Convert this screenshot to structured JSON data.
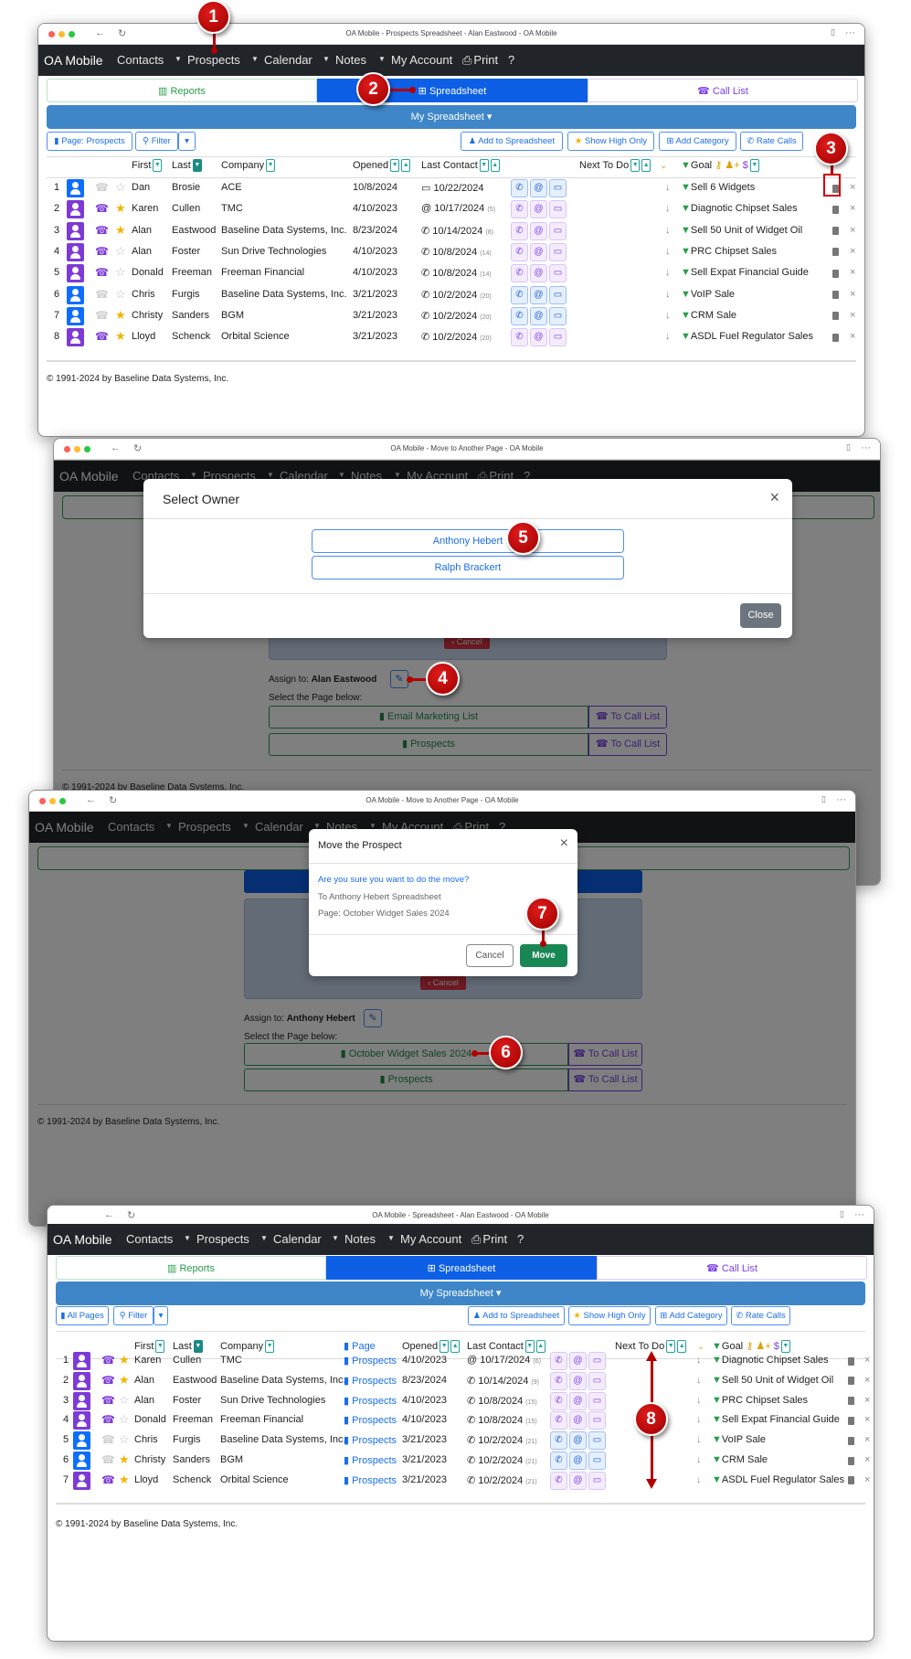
{
  "nav": {
    "brand": "OA Mobile",
    "items": [
      "Contacts",
      "Prospects",
      "Calendar",
      "Notes",
      "My Account",
      "Print",
      "?"
    ]
  },
  "colors": {
    "nav_bg": "#212529",
    "spreadsheet_tab": "#0d5fe6",
    "reports_text": "#2a9d4a",
    "call_list_text": "#7b3fe4",
    "person_blue": "#0d6efd",
    "person_purple": "#7d3ad6",
    "teal_sort": "#20a39e",
    "move_button": "#198754",
    "close_button": "#6c757d",
    "cancel_red": "#dc3545",
    "callout_red": "#b30000"
  },
  "callouts": [
    "1",
    "2",
    "3",
    "4",
    "5",
    "6",
    "7",
    "8"
  ],
  "window1": {
    "title": "OA Mobile - Prospects Spreadsheet - Alan Eastwood - OA Mobile",
    "tabs": {
      "reports": "Reports",
      "spreadsheet": "Spreadsheet",
      "call_list": "Call List"
    },
    "my_spreadsheet": "My Spreadsheet",
    "toolbar": {
      "page": "Page: Prospects",
      "filter": "Filter",
      "add": "Add to Spreadsheet",
      "high": "Show High Only",
      "category": "Add Category",
      "rate": "Rate Calls"
    },
    "headers": {
      "first": "First",
      "last": "Last",
      "company": "Company",
      "opened": "Opened",
      "last_contact": "Last Contact",
      "next": "Next To Do",
      "goal": "Goal"
    },
    "rows": [
      {
        "n": "1",
        "color": "blue",
        "star": false,
        "first": "Dan",
        "last": "Brosie",
        "company": "ACE",
        "opened": "10/8/2024",
        "lc_icon": "comment",
        "last_contact": "10/22/2024",
        "days": "",
        "goal": "Sell 6 Widgets"
      },
      {
        "n": "2",
        "color": "purple",
        "star": true,
        "first": "Karen",
        "last": "Cullen",
        "company": "TMC",
        "opened": "4/10/2023",
        "lc_icon": "email",
        "last_contact": "10/17/2024",
        "days": "(5)",
        "goal": "Diagnotic Chipset Sales"
      },
      {
        "n": "3",
        "color": "purple",
        "star": true,
        "first": "Alan",
        "last": "Eastwood",
        "company": "Baseline Data Systems, Inc.",
        "opened": "8/23/2024",
        "lc_icon": "phone",
        "last_contact": "10/14/2024",
        "days": "(8)",
        "goal": "Sell 50 Unit of Widget Oil"
      },
      {
        "n": "4",
        "color": "purple",
        "star": false,
        "first": "Alan",
        "last": "Foster",
        "company": "Sun Drive Technologies",
        "opened": "4/10/2023",
        "lc_icon": "phone",
        "last_contact": "10/8/2024",
        "days": "(14)",
        "goal": "PRC Chipset Sales"
      },
      {
        "n": "5",
        "color": "purple",
        "star": false,
        "first": "Donald",
        "last": "Freeman",
        "company": "Freeman Financial",
        "opened": "4/10/2023",
        "lc_icon": "phone",
        "last_contact": "10/8/2024",
        "days": "(14)",
        "goal": "Sell Expat Financial Guide"
      },
      {
        "n": "6",
        "color": "blue",
        "star": false,
        "first": "Chris",
        "last": "Furgis",
        "company": "Baseline Data Systems, Inc.",
        "opened": "3/21/2023",
        "lc_icon": "phone",
        "last_contact": "10/2/2024",
        "days": "(20)",
        "goal": "VoIP Sale"
      },
      {
        "n": "7",
        "color": "blue",
        "star": true,
        "first": "Christy",
        "last": "Sanders",
        "company": "BGM",
        "opened": "3/21/2023",
        "lc_icon": "phone",
        "last_contact": "10/2/2024",
        "days": "(20)",
        "goal": "CRM Sale"
      },
      {
        "n": "8",
        "color": "purple",
        "star": true,
        "first": "Lloyd",
        "last": "Schenck",
        "company": "Orbital Science",
        "opened": "3/21/2023",
        "lc_icon": "phone",
        "last_contact": "10/2/2024",
        "days": "(20)",
        "goal": "ASDL Fuel Regulator Sales"
      }
    ],
    "footer": "© 1991-2024 by Baseline Data Systems, Inc."
  },
  "window2": {
    "title": "OA Mobile - Move to Another Page - OA Mobile",
    "modal": {
      "title": "Select Owner",
      "owners": [
        "Anthony Hebert",
        "Ralph Brackert"
      ],
      "close": "Close"
    },
    "cancel": "Cancel",
    "assign_label": "Assign to:",
    "assign_name": "Alan Eastwood",
    "select_page": "Select the Page below:",
    "pages": [
      "Email Marketing List",
      "Prospects"
    ],
    "to_call_list": "To Call List",
    "footer": "© 1991-2024 by Baseline Data Systems, Inc."
  },
  "window3": {
    "title": "OA Mobile - Move to Another Page - OA Mobile",
    "modal": {
      "title": "Move the Prospect",
      "question": "Are you sure you want to do the move?",
      "line1": "To Anthony Hebert Spreadsheet",
      "line2": "Page: October Widget Sales 2024",
      "cancel": "Cancel",
      "move": "Move"
    },
    "cancel": "Cancel",
    "assign_label": "Assign to:",
    "assign_name": "Anthony Hebert",
    "select_page": "Select the Page below:",
    "pages": [
      "October Widget Sales 2024",
      "Prospects"
    ],
    "to_call_list": "To Call List",
    "footer": "© 1991-2024 by Baseline Data Systems, Inc."
  },
  "window4": {
    "title": "OA Mobile - Spreadsheet - Alan Eastwood - OA Mobile",
    "tabs": {
      "reports": "Reports",
      "spreadsheet": "Spreadsheet",
      "call_list": "Call List"
    },
    "my_spreadsheet": "My Spreadsheet",
    "toolbar": {
      "page": "All Pages",
      "filter": "Filter",
      "add": "Add to Spreadsheet",
      "high": "Show High Only",
      "category": "Add Category",
      "rate": "Rate Calls"
    },
    "headers": {
      "first": "First",
      "last": "Last",
      "company": "Company",
      "page": "Page",
      "opened": "Opened",
      "last_contact": "Last Contact",
      "next": "Next To Do",
      "goal": "Goal"
    },
    "rows": [
      {
        "n": "1",
        "color": "purple",
        "star": true,
        "first": "Karen",
        "last": "Cullen",
        "company": "TMC",
        "page": "Prospects",
        "opened": "4/10/2023",
        "lc_icon": "email",
        "last_contact": "10/17/2024",
        "days": "(6)",
        "goal": "Diagnotic Chipset Sales"
      },
      {
        "n": "2",
        "color": "purple",
        "star": true,
        "first": "Alan",
        "last": "Eastwood",
        "company": "Baseline Data Systems, Inc.",
        "page": "Prospects",
        "opened": "8/23/2024",
        "lc_icon": "phone",
        "last_contact": "10/14/2024",
        "days": "(9)",
        "goal": "Sell 50 Unit of Widget Oil"
      },
      {
        "n": "3",
        "color": "purple",
        "star": false,
        "first": "Alan",
        "last": "Foster",
        "company": "Sun Drive Technologies",
        "page": "Prospects",
        "opened": "4/10/2023",
        "lc_icon": "phone",
        "last_contact": "10/8/2024",
        "days": "(15)",
        "goal": "PRC Chipset Sales"
      },
      {
        "n": "4",
        "color": "purple",
        "star": false,
        "first": "Donald",
        "last": "Freeman",
        "company": "Freeman Financial",
        "page": "Prospects",
        "opened": "4/10/2023",
        "lc_icon": "phone",
        "last_contact": "10/8/2024",
        "days": "(15)",
        "goal": "Sell Expat Financial Guide"
      },
      {
        "n": "5",
        "color": "blue",
        "star": false,
        "first": "Chris",
        "last": "Furgis",
        "company": "Baseline Data Systems, Inc.",
        "page": "Prospects",
        "opened": "3/21/2023",
        "lc_icon": "phone",
        "last_contact": "10/2/2024",
        "days": "(21)",
        "goal": "VoIP Sale"
      },
      {
        "n": "6",
        "color": "blue",
        "star": true,
        "first": "Christy",
        "last": "Sanders",
        "company": "BGM",
        "page": "Prospects",
        "opened": "3/21/2023",
        "lc_icon": "phone",
        "last_contact": "10/2/2024",
        "days": "(21)",
        "goal": "CRM Sale"
      },
      {
        "n": "7",
        "color": "purple",
        "star": true,
        "first": "Lloyd",
        "last": "Schenck",
        "company": "Orbital Science",
        "page": "Prospects",
        "opened": "3/21/2023",
        "lc_icon": "phone",
        "last_contact": "10/2/2024",
        "days": "(21)",
        "goal": "ASDL Fuel Regulator Sales"
      }
    ],
    "footer": "© 1991-2024 by Baseline Data Systems, Inc."
  }
}
